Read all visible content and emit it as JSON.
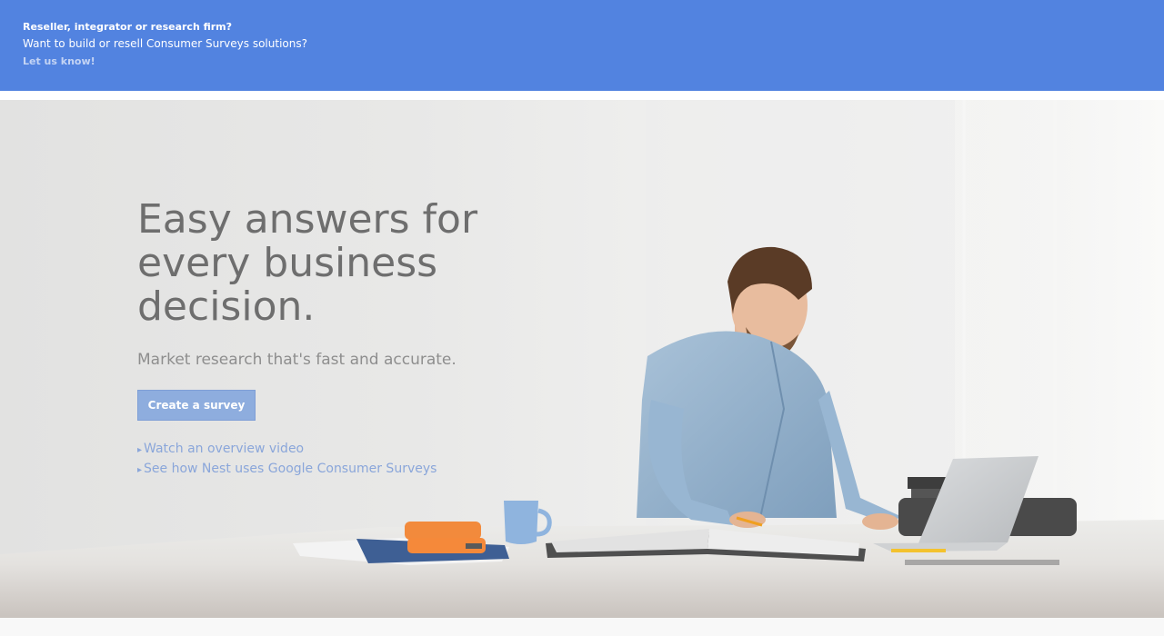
{
  "banner": {
    "title": "Reseller, integrator or research firm?",
    "text": "Want to build or resell Consumer Surveys solutions?",
    "link": "Let us know!"
  },
  "hero": {
    "headline": "Easy answers for every business decision.",
    "subline": "Market research that's fast and accurate.",
    "cta_label": "Create a survey",
    "links": [
      {
        "arrow": "▸",
        "label": "Watch an overview video"
      },
      {
        "arrow": "▸",
        "label": "See how Nest uses Google Consumer Surveys"
      }
    ],
    "image": "man-at-desk-with-laptop-photo"
  },
  "colors": {
    "banner_bg": "#5283e0",
    "cta_bg": "#8eadde",
    "link": "#8aa6da",
    "headline": "#6e6e6e"
  }
}
